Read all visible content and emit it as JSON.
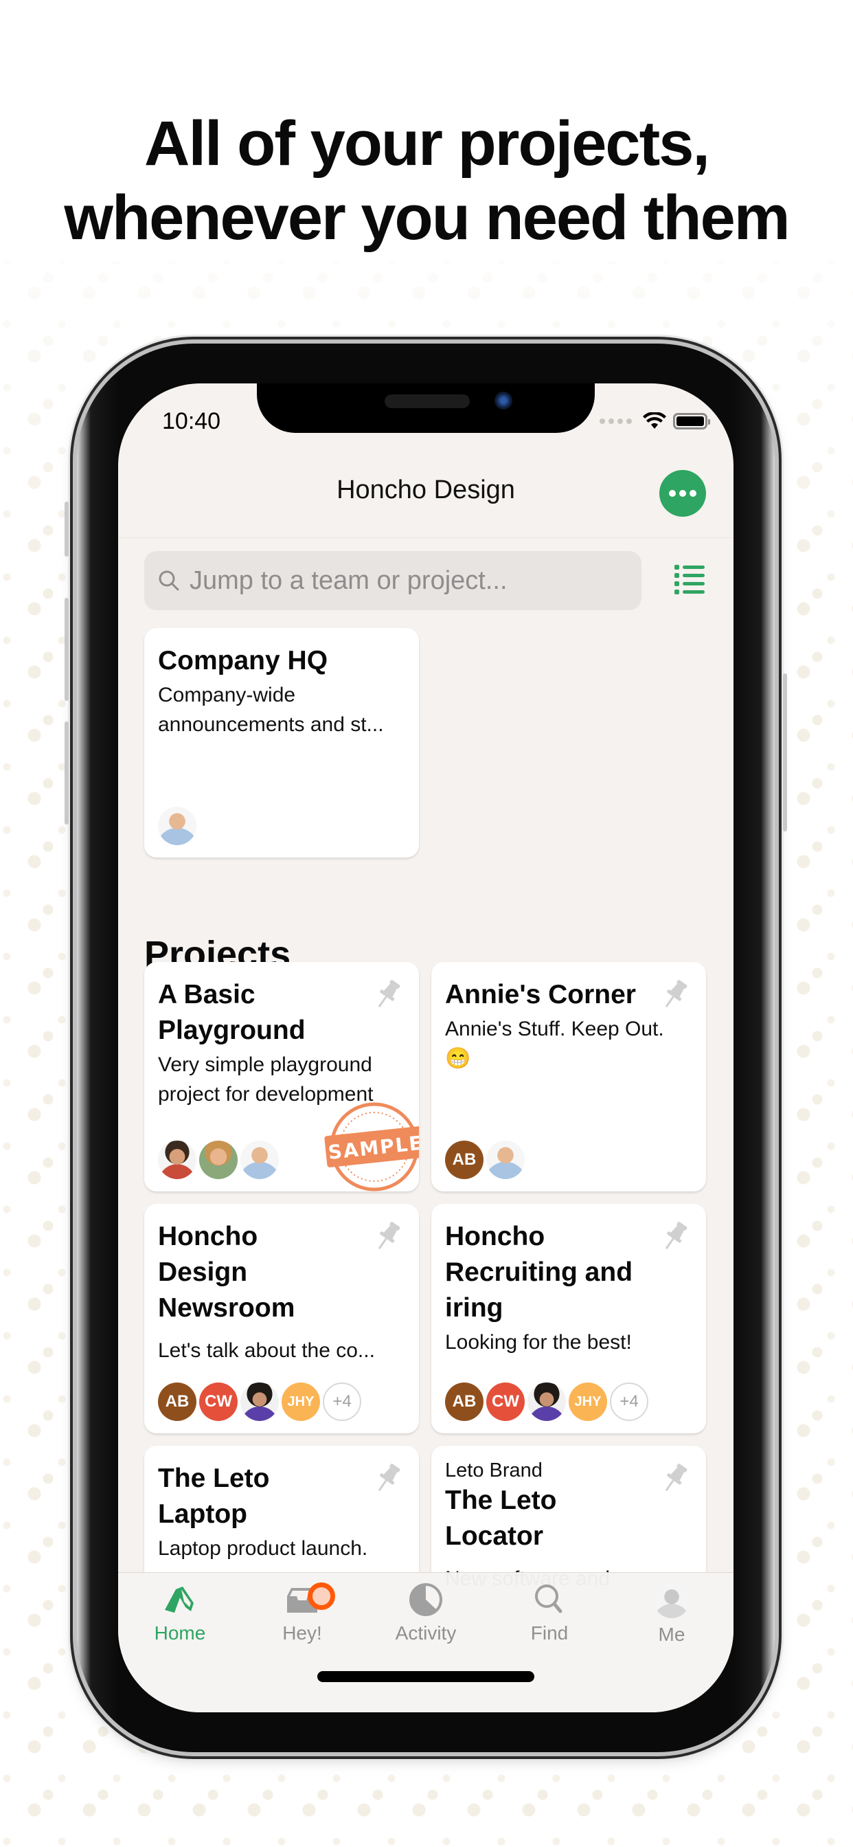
{
  "headline": {
    "line1": "All of your projects,",
    "line2": "whenever you need them"
  },
  "status_bar": {
    "time": "10:40",
    "icons": [
      "cellular-signal-icon",
      "wifi-icon",
      "battery-icon"
    ]
  },
  "nav": {
    "title": "Honcho Design",
    "more_icon": "ellipsis-icon",
    "list_icon": "list-view-icon"
  },
  "search": {
    "placeholder": "Jump to a team or project..."
  },
  "company_card": {
    "title": "Company HQ",
    "description": "Company-wide announcements and st...",
    "avatars": [
      {
        "type": "photo",
        "label": "person-with-glasses"
      }
    ]
  },
  "projects": {
    "heading": "Projects",
    "items": [
      {
        "pretitle": "",
        "title": "A Basic Playground",
        "description": "Very simple playground project for development",
        "pinned_icon": "pin-icon",
        "badge": "SAMPLE",
        "avatars": [
          {
            "type": "photo",
            "label": "woman-pulling-ears"
          },
          {
            "type": "photo",
            "label": "woman-curly-hair"
          },
          {
            "type": "photo",
            "label": "person-with-glasses"
          }
        ]
      },
      {
        "pretitle": "",
        "title": "Annie's Corner",
        "description": "Annie's Stuff. Keep Out. 😁",
        "pinned_icon": "pin-icon",
        "avatars": [
          {
            "type": "initials",
            "text": "AB",
            "color": "#8f4f1c"
          },
          {
            "type": "photo",
            "label": "person-with-glasses"
          }
        ]
      },
      {
        "pretitle": "",
        "title": "Honcho Design Newsroom",
        "description": "Let's talk about the co...",
        "pinned_icon": "pin-icon",
        "avatars": [
          {
            "type": "initials",
            "text": "AB",
            "color": "#8f4f1c"
          },
          {
            "type": "initials",
            "text": "CW",
            "color": "#e4503a"
          },
          {
            "type": "photo",
            "label": "man-curly-hair"
          },
          {
            "type": "initials",
            "text": "JHY",
            "color": "#fbb454"
          },
          {
            "type": "more",
            "text": "+4"
          }
        ]
      },
      {
        "pretitle": "",
        "title": "Honcho Recruiting and iring",
        "description": "Looking for the best!",
        "pinned_icon": "pin-icon",
        "avatars": [
          {
            "type": "initials",
            "text": "AB",
            "color": "#8f4f1c"
          },
          {
            "type": "initials",
            "text": "CW",
            "color": "#e4503a"
          },
          {
            "type": "photo",
            "label": "man-curly-hair"
          },
          {
            "type": "initials",
            "text": "JHY",
            "color": "#fbb454"
          },
          {
            "type": "more",
            "text": "+4"
          }
        ]
      },
      {
        "pretitle": "",
        "title": "The Leto Laptop",
        "description": "Laptop product launch.",
        "pinned_icon": "pin-icon",
        "avatars": []
      },
      {
        "pretitle": "Leto Brand",
        "title": "The Leto Locator",
        "description": "New software and",
        "pinned_icon": "pin-icon",
        "avatars": []
      }
    ]
  },
  "tabbar": {
    "tabs": [
      {
        "label": "Home",
        "icon": "home-tent-icon",
        "active": true
      },
      {
        "label": "Hey!",
        "icon": "inbox-tray-icon",
        "active": false,
        "has_badge": true
      },
      {
        "label": "Activity",
        "icon": "activity-pie-icon",
        "active": false
      },
      {
        "label": "Find",
        "icon": "search-icon",
        "active": false
      },
      {
        "label": "Me",
        "icon": "user-avatar",
        "active": false
      }
    ]
  },
  "colors": {
    "brand_green": "#2ea562",
    "badge_orange": "#ff5a0a",
    "sample_stamp": "#ef8a5a",
    "screen_bg": "#f5f2ef",
    "search_bg": "#e8e4e1",
    "inactive_tab": "#8f8f8f"
  }
}
